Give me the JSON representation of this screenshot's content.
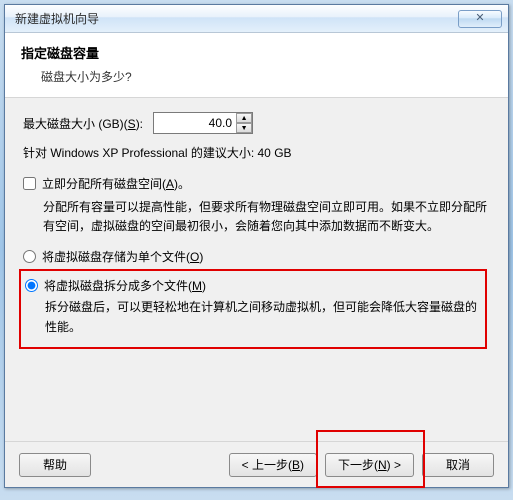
{
  "window": {
    "title": "新建虚拟机向导",
    "close_glyph": "✕"
  },
  "header": {
    "heading": "指定磁盘容量",
    "sub": "磁盘大小为多少?"
  },
  "size": {
    "label_prefix": "最大磁盘大小 (GB)(",
    "label_key": "S",
    "label_suffix": "):",
    "value": "40.0"
  },
  "hint": "针对 Windows XP Professional 的建议大小: 40 GB",
  "allocate": {
    "label_prefix": "立即分配所有磁盘空间(",
    "label_key": "A",
    "label_suffix": ")。",
    "desc": "分配所有容量可以提高性能，但要求所有物理磁盘空间立即可用。如果不立即分配所有空间，虚拟磁盘的空间最初很小，会随着您向其中添加数据而不断变大。"
  },
  "radio_single": {
    "label_prefix": "将虚拟磁盘存储为单个文件(",
    "label_key": "O",
    "label_suffix": ")"
  },
  "radio_split": {
    "label_prefix": "将虚拟磁盘拆分成多个文件(",
    "label_key": "M",
    "label_suffix": ")",
    "desc": "拆分磁盘后，可以更轻松地在计算机之间移动虚拟机，但可能会降低大容量磁盘的性能。"
  },
  "footer": {
    "help": "帮助",
    "back_prefix": "< 上一步(",
    "back_key": "B",
    "back_suffix": ")",
    "next_prefix": "下一步(",
    "next_key": "N",
    "next_suffix": ") >",
    "cancel": "取消"
  }
}
